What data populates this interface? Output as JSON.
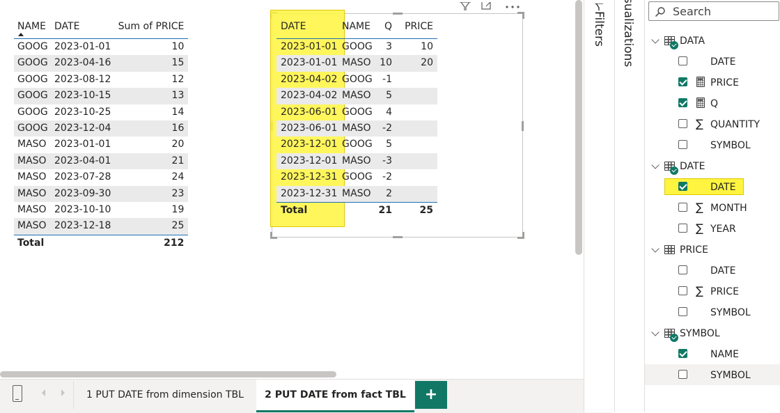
{
  "table1": {
    "headers": [
      "NAME",
      "DATE",
      "Sum of PRICE"
    ],
    "rows": [
      [
        "GOOG",
        "2023-01-01",
        "10"
      ],
      [
        "GOOG",
        "2023-04-16",
        "15"
      ],
      [
        "GOOG",
        "2023-08-12",
        "12"
      ],
      [
        "GOOG",
        "2023-10-15",
        "13"
      ],
      [
        "GOOG",
        "2023-10-25",
        "14"
      ],
      [
        "GOOG",
        "2023-12-04",
        "16"
      ],
      [
        "MASO",
        "2023-01-01",
        "20"
      ],
      [
        "MASO",
        "2023-04-01",
        "21"
      ],
      [
        "MASO",
        "2023-07-28",
        "24"
      ],
      [
        "MASO",
        "2023-09-30",
        "23"
      ],
      [
        "MASO",
        "2023-10-10",
        "19"
      ],
      [
        "MASO",
        "2023-12-18",
        "25"
      ]
    ],
    "total_label": "Total",
    "total_value": "212"
  },
  "table2": {
    "headers": [
      "DATE",
      "NAME",
      "Q",
      "PRICE"
    ],
    "rows": [
      [
        "2023-01-01",
        "GOOG",
        "3",
        "10"
      ],
      [
        "2023-01-01",
        "MASO",
        "10",
        "20"
      ],
      [
        "2023-04-02",
        "GOOG",
        "-1",
        ""
      ],
      [
        "2023-04-02",
        "MASO",
        "5",
        ""
      ],
      [
        "2023-06-01",
        "GOOG",
        "4",
        ""
      ],
      [
        "2023-06-01",
        "MASO",
        "-2",
        ""
      ],
      [
        "2023-12-01",
        "GOOG",
        "5",
        ""
      ],
      [
        "2023-12-01",
        "MASO",
        "-3",
        ""
      ],
      [
        "2023-12-31",
        "GOOG",
        "-2",
        ""
      ],
      [
        "2023-12-31",
        "MASO",
        "2",
        ""
      ]
    ],
    "total_label": "Total",
    "total_q": "21",
    "total_price": "25"
  },
  "visual_header_icons": [
    "filter-icon",
    "focus-mode-icon",
    "more-options-icon"
  ],
  "tabs": {
    "tab1": "1 PUT DATE from dimension TBL",
    "tab2": "2 PUT DATE from fact TBL",
    "add": "+"
  },
  "panes": {
    "filters_label": "Filters",
    "visualizations_label": "Visualizations",
    "search_placeholder": "Search"
  },
  "fields": [
    {
      "kind": "table",
      "label": "DATA",
      "badge": true
    },
    {
      "kind": "field",
      "label": "DATE",
      "checked": false,
      "icon": "none"
    },
    {
      "kind": "field",
      "label": "PRICE",
      "checked": true,
      "icon": "calculator"
    },
    {
      "kind": "field",
      "label": "Q",
      "checked": true,
      "icon": "calculator"
    },
    {
      "kind": "field",
      "label": "QUANTITY",
      "checked": false,
      "icon": "sigma"
    },
    {
      "kind": "field",
      "label": "SYMBOL",
      "checked": false,
      "icon": "none"
    },
    {
      "kind": "table",
      "label": "DATE",
      "badge": true
    },
    {
      "kind": "field",
      "label": "DATE",
      "checked": true,
      "icon": "none",
      "highlight": true
    },
    {
      "kind": "field",
      "label": "MONTH",
      "checked": false,
      "icon": "sigma"
    },
    {
      "kind": "field",
      "label": "YEAR",
      "checked": false,
      "icon": "sigma"
    },
    {
      "kind": "table",
      "label": "PRICE",
      "badge": false
    },
    {
      "kind": "field",
      "label": "DATE",
      "checked": false,
      "icon": "none"
    },
    {
      "kind": "field",
      "label": "PRICE",
      "checked": false,
      "icon": "sigma"
    },
    {
      "kind": "field",
      "label": "SYMBOL",
      "checked": false,
      "icon": "none"
    },
    {
      "kind": "table",
      "label": "SYMBOL",
      "badge": true
    },
    {
      "kind": "field",
      "label": "NAME",
      "checked": true,
      "icon": "none"
    },
    {
      "kind": "field",
      "label": "SYMBOL",
      "checked": false,
      "icon": "none",
      "hover": true
    }
  ],
  "colors": {
    "accent": "#117865",
    "highlight": "#fff440",
    "table_line": "#1f6fb5"
  }
}
